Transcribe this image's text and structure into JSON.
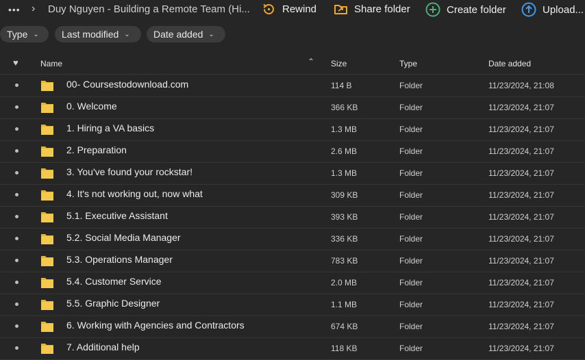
{
  "header": {
    "more_glyph": "•••",
    "breadcrumb": "Duy Nguyen - Building a Remote Team (Hi...",
    "actions": [
      {
        "label": "Rewind",
        "icon": "rewind-icon",
        "color": "#f5a623"
      },
      {
        "label": "Share folder",
        "icon": "share-folder-icon",
        "color": "#f5a623"
      },
      {
        "label": "Create folder",
        "icon": "create-folder-icon",
        "color": "#4caf7a"
      },
      {
        "label": "Upload...",
        "icon": "upload-icon",
        "color": "#3d9be9"
      }
    ]
  },
  "filters": [
    {
      "label": "Type"
    },
    {
      "label": "Last modified"
    },
    {
      "label": "Date added"
    }
  ],
  "table": {
    "columns": {
      "fav": "♥",
      "name": "Name",
      "size": "Size",
      "type": "Type",
      "date": "Date added"
    },
    "rows": [
      {
        "name": "00- Coursestodownload.com",
        "size": "114 B",
        "type": "Folder",
        "date": "11/23/2024, 21:08"
      },
      {
        "name": "0. Welcome",
        "size": "366 KB",
        "type": "Folder",
        "date": "11/23/2024, 21:07"
      },
      {
        "name": "1. Hiring a VA basics",
        "size": "1.3 MB",
        "type": "Folder",
        "date": "11/23/2024, 21:07"
      },
      {
        "name": "2. Preparation",
        "size": "2.6 MB",
        "type": "Folder",
        "date": "11/23/2024, 21:07"
      },
      {
        "name": "3. You've found your rockstar!",
        "size": "1.3 MB",
        "type": "Folder",
        "date": "11/23/2024, 21:07"
      },
      {
        "name": "4. It's not working out, now what",
        "size": "309 KB",
        "type": "Folder",
        "date": "11/23/2024, 21:07"
      },
      {
        "name": "5.1. Executive Assistant",
        "size": "393 KB",
        "type": "Folder",
        "date": "11/23/2024, 21:07"
      },
      {
        "name": "5.2. Social Media Manager",
        "size": "336 KB",
        "type": "Folder",
        "date": "11/23/2024, 21:07"
      },
      {
        "name": "5.3. Operations Manager",
        "size": "783 KB",
        "type": "Folder",
        "date": "11/23/2024, 21:07"
      },
      {
        "name": "5.4. Customer Service",
        "size": "2.0 MB",
        "type": "Folder",
        "date": "11/23/2024, 21:07"
      },
      {
        "name": "5.5. Graphic Designer",
        "size": "1.1 MB",
        "type": "Folder",
        "date": "11/23/2024, 21:07"
      },
      {
        "name": "6. Working with Agencies and Contractors",
        "size": "674 KB",
        "type": "Folder",
        "date": "11/23/2024, 21:07"
      },
      {
        "name": "7. Additional help",
        "size": "118 KB",
        "type": "Folder",
        "date": "11/23/2024, 21:07"
      }
    ]
  },
  "colors": {
    "folder": "#f2c94c",
    "folder_tab": "#e0b43c"
  }
}
